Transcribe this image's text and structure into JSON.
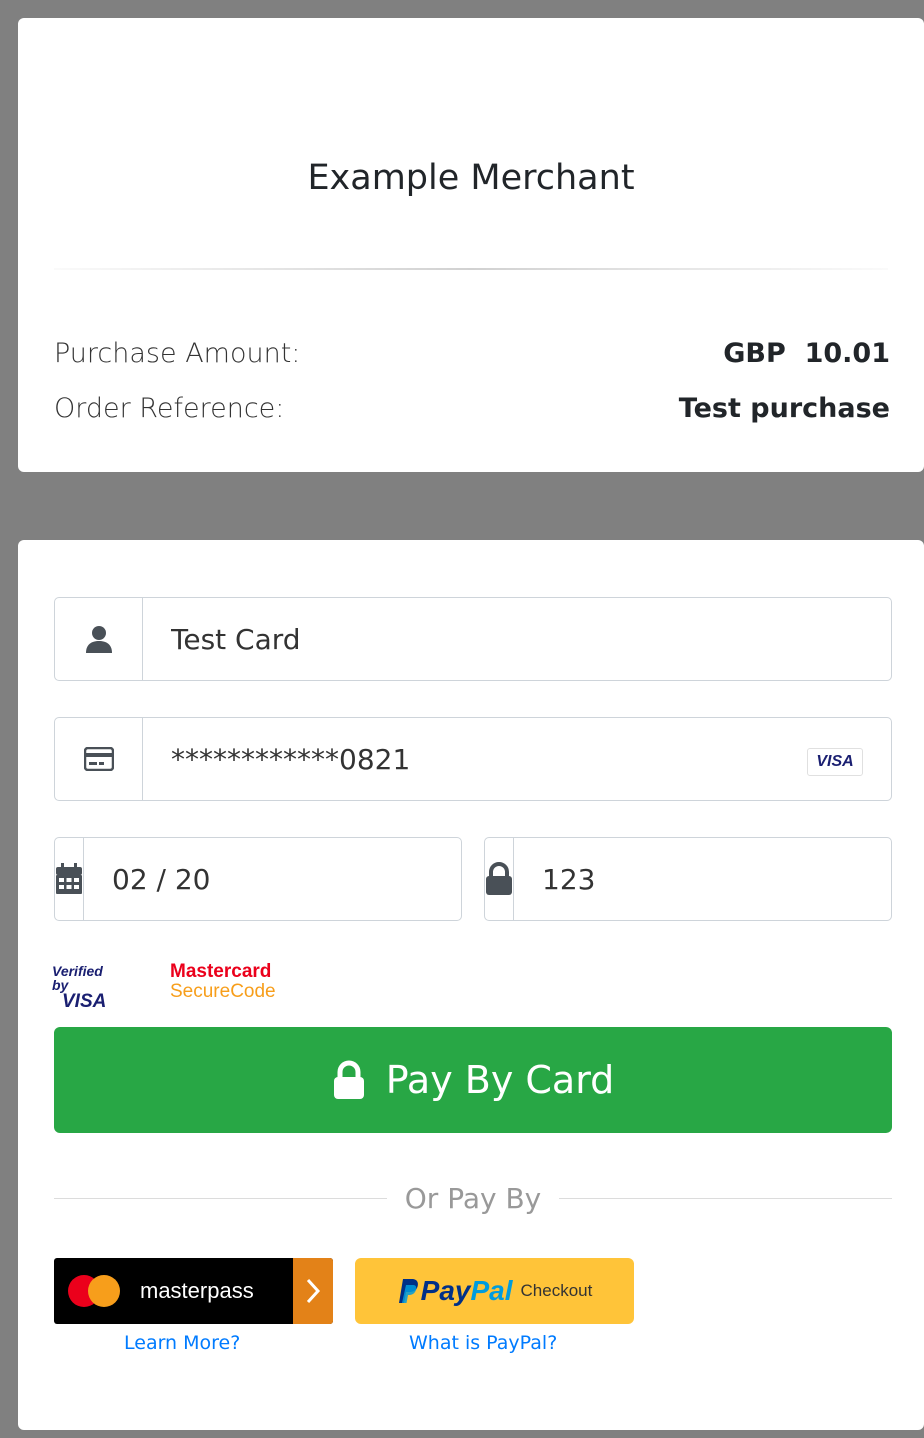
{
  "merchant": {
    "name": "Example Merchant"
  },
  "summary": {
    "amount_label": "Purchase Amount:",
    "amount_value": "GBP  10.01",
    "reference_label": "Order Reference:",
    "reference_value": "Test purchase"
  },
  "form": {
    "name_value": "Test Card",
    "card_value": "************0821",
    "card_brand": "VISA",
    "expiry_value": "02 / 20",
    "cvv_value": "123",
    "icons": {
      "name": "user-icon",
      "card": "credit-card-icon",
      "expiry": "calendar-icon",
      "cvv": "lock-icon"
    }
  },
  "security_badges": {
    "verified_by": "Verified by",
    "visa": "VISA",
    "mastercard": "Mastercard",
    "securecode": "SecureCode"
  },
  "pay_button": {
    "label": "Pay By Card",
    "color": "#28a745"
  },
  "alternatives": {
    "divider_label": "Or Pay By",
    "masterpass": {
      "label": "masterpass",
      "link": "Learn More?"
    },
    "paypal": {
      "pay": "Pay",
      "pal": "Pal",
      "checkout": "Checkout",
      "link": "What is PayPal?"
    }
  },
  "colors": {
    "background": "#808080",
    "panel": "#ffffff",
    "link": "#007bff",
    "paypal_yellow": "#ffc439",
    "masterpass_orange": "#e38218"
  }
}
